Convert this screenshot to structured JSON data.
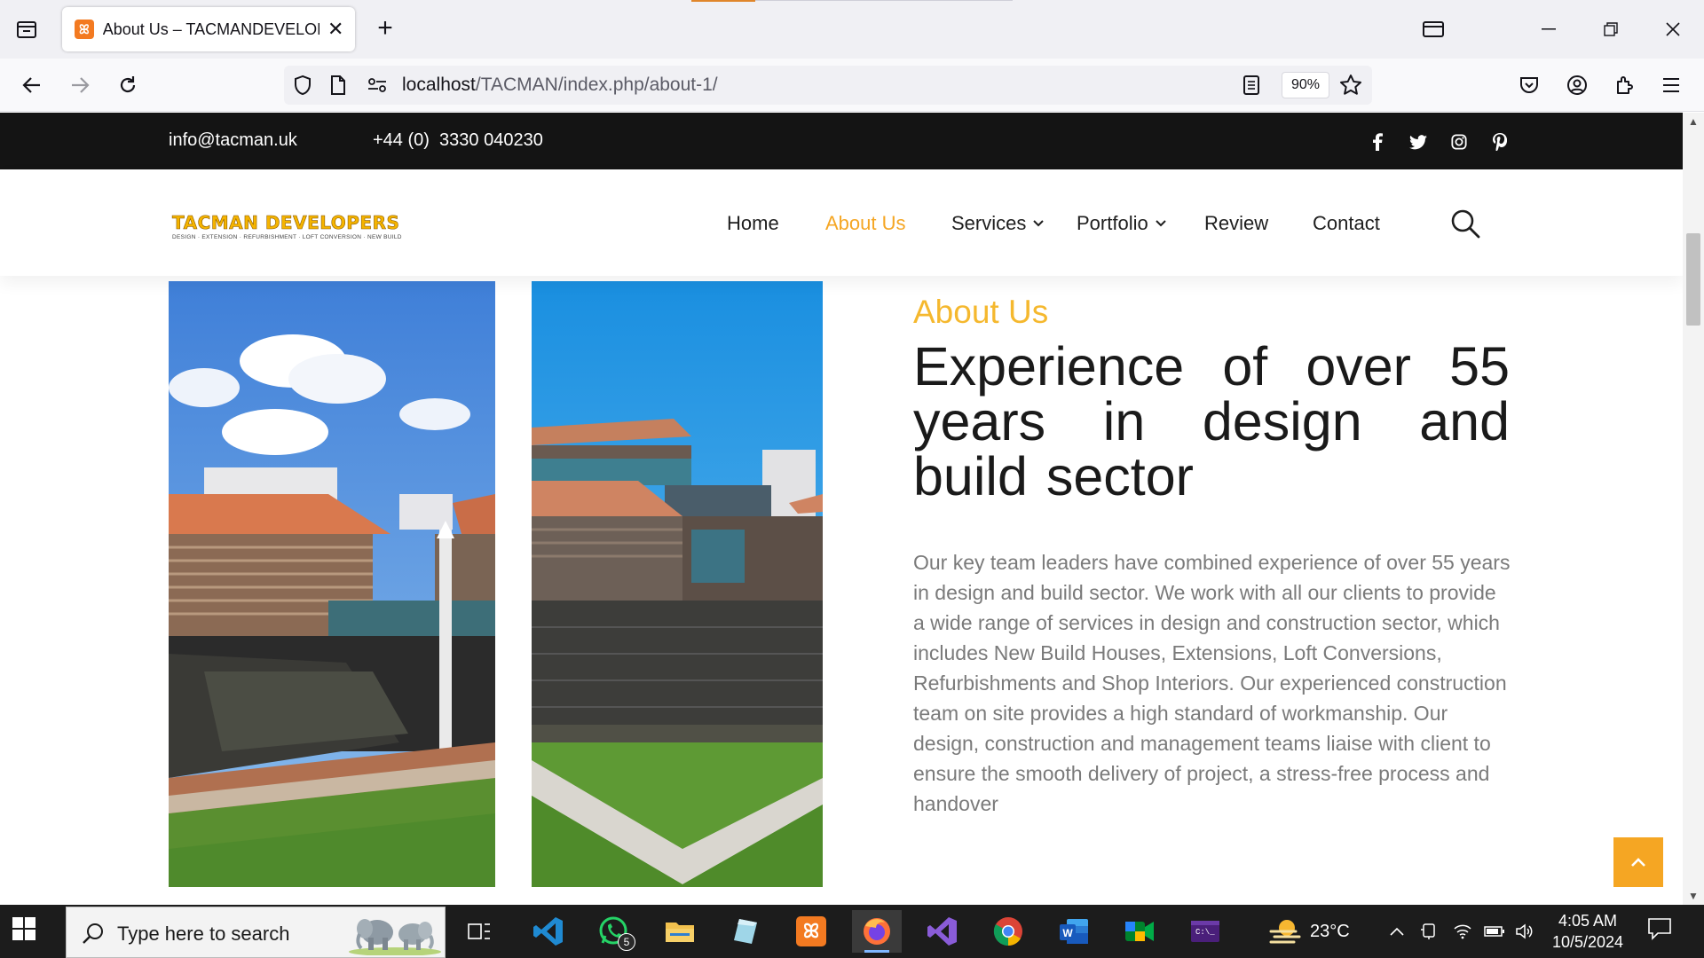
{
  "browser": {
    "tab_title": "About Us – TACMANDEVELOPERS",
    "url_host": "localhost",
    "url_path": "/TACMAN/index.php/about-1/",
    "zoom": "90%"
  },
  "topbar": {
    "email": "info@tacman.uk",
    "phone": "+44 (0)  3330 040230",
    "social": [
      "facebook-icon",
      "twitter-icon",
      "instagram-icon",
      "pinterest-icon"
    ]
  },
  "header": {
    "logo_main": "TACMAN DEVELOPERS",
    "logo_sub": "DESIGN · EXTENSION · REFURBISHMENT · LOFT CONVERSION · NEW BUILD",
    "menu": [
      {
        "label": "Home"
      },
      {
        "label": "About Us",
        "active": true
      },
      {
        "label": "Services",
        "dropdown": true
      },
      {
        "label": "Portfolio",
        "dropdown": true
      },
      {
        "label": "Review"
      },
      {
        "label": "Contact"
      }
    ]
  },
  "about": {
    "label": "About Us",
    "headline": "Experience of over 55 years in design and build sector",
    "body": "Our key team leaders have combined experience of over 55 years in design and build sector. We work with all our clients to provide a wide range of services in design and construction sector, which includes New Build Houses, Extensions, Loft Conversions, Refurbishments and Shop Interiors. Our experienced construction team on site provides a high standard of workmanship. Our design, construction and management teams liaise with client to ensure the smooth delivery of project, a stress-free process and handover"
  },
  "colors": {
    "accent": "#f5a623",
    "topbar": "#141414",
    "body_text": "#7a7a7a"
  },
  "taskbar": {
    "search_placeholder": "Type here to search",
    "whatsapp_badge": "5",
    "temperature": "23°C",
    "time": "4:05 AM",
    "date": "10/5/2024"
  }
}
